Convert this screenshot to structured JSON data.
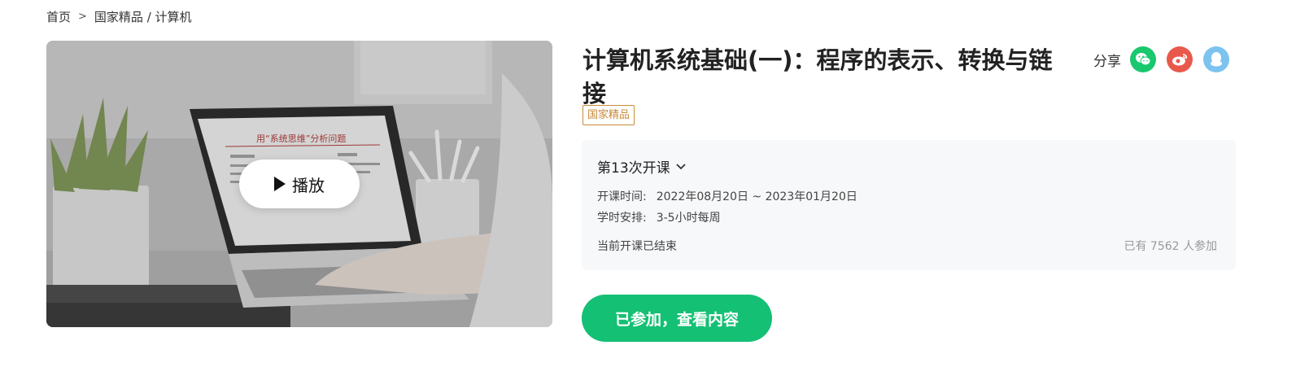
{
  "breadcrumb": {
    "home": "首页",
    "separator": ">",
    "path": "国家精品 / 计算机"
  },
  "video": {
    "play_label": "播放",
    "slide_title": "用“系统思维”分析问题"
  },
  "course": {
    "title": "计算机系统基础(一)：程序的表示、转换与链接",
    "tag": "国家精品"
  },
  "share": {
    "label": "分享",
    "icons": [
      "wechat-icon",
      "weibo-icon",
      "qq-icon"
    ]
  },
  "term": {
    "selector_label": "第13次开课",
    "date_key": "开课时间:",
    "date_value": "2022年08月20日 ~ 2023年01月20日",
    "schedule_key": "学时安排:",
    "schedule_value": "3-5小时每周",
    "status": "当前开课已结束",
    "enrolled": "已有 7562 人参加"
  },
  "cta": {
    "label": "已参加，查看内容"
  },
  "colors": {
    "accent_green": "#14c074",
    "tag_gold": "#c98b39",
    "wechat": "#1ac86e",
    "weibo": "#e8594c",
    "qq": "#7cc3ef",
    "panel_bg": "#f7f8fa"
  }
}
